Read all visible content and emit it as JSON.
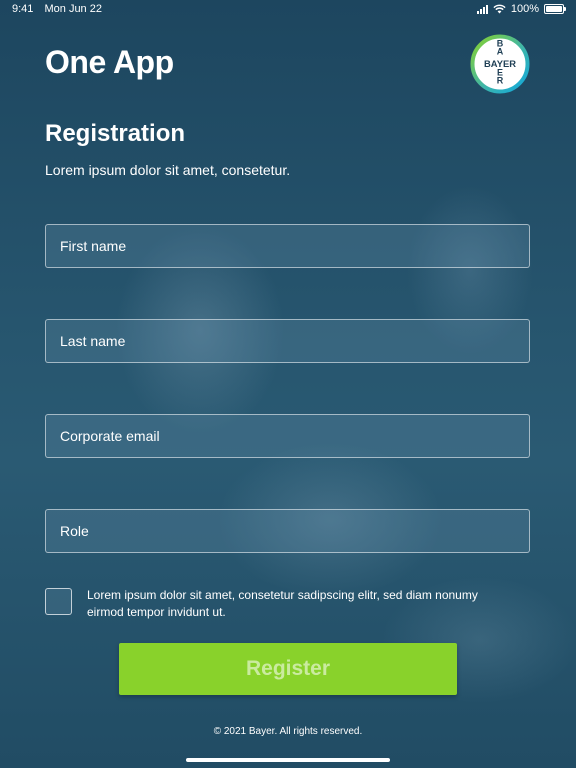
{
  "status_bar": {
    "time": "9:41",
    "date": "Mon Jun 22",
    "battery": "100%",
    "icons": [
      "signal-icon",
      "wifi-icon",
      "battery-icon"
    ]
  },
  "header": {
    "app_title": "One App",
    "logo_text": "BAYER"
  },
  "form": {
    "heading": "Registration",
    "subtitle": "Lorem ipsum dolor sit amet, consetetur.",
    "fields": [
      {
        "placeholder": "First name",
        "value": ""
      },
      {
        "placeholder": "Last name",
        "value": ""
      },
      {
        "placeholder": "Corporate email",
        "value": ""
      },
      {
        "placeholder": "Role",
        "value": ""
      }
    ],
    "consent_checked": false,
    "consent_text": "Lorem ipsum dolor sit amet, consetetur sadipscing elitr, sed diam nonumy eirmod tempor invidunt ut.",
    "register_label": "Register"
  },
  "footer": {
    "copyright": "© 2021 Bayer. All rights reserved."
  },
  "colors": {
    "background": "#1f4a64",
    "accent_green": "#89d22b",
    "logo_ring_green": "#89d22b",
    "logo_ring_blue": "#10a8e0"
  }
}
